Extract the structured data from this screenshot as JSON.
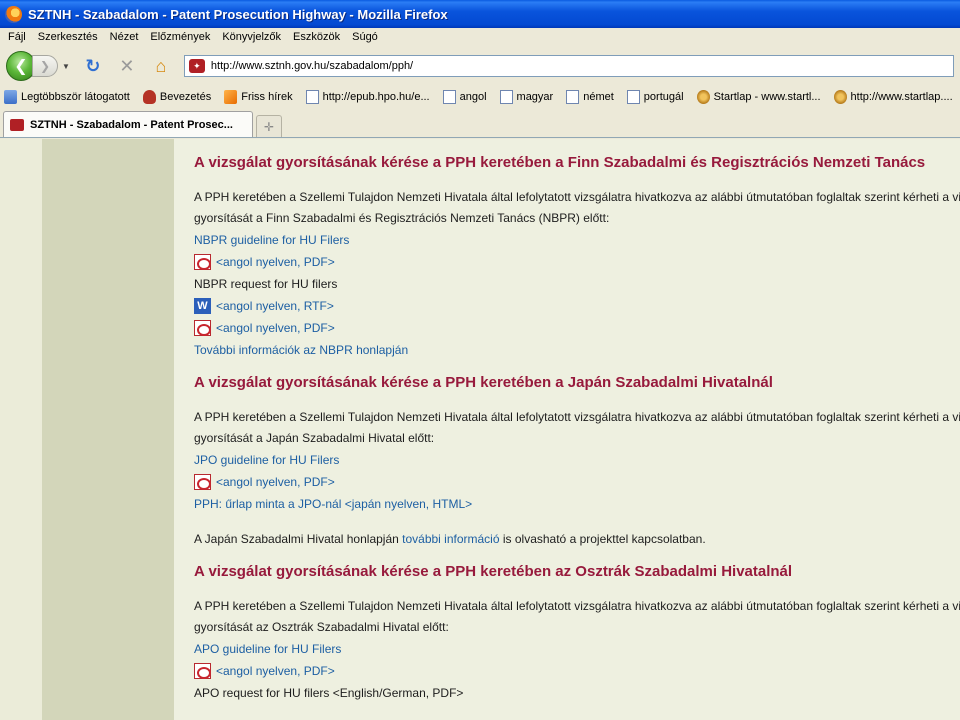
{
  "window": {
    "title": "SZTNH - Szabadalom - Patent Prosecution Highway - Mozilla Firefox"
  },
  "menu": {
    "items": [
      "Fájl",
      "Szerkesztés",
      "Nézet",
      "Előzmények",
      "Könyvjelzők",
      "Eszközök",
      "Súgó"
    ]
  },
  "nav": {
    "url": "http://www.sztnh.gov.hu/szabadalom/pph/"
  },
  "bookmarks": {
    "items": [
      {
        "label": "Legtöbbször látogatott",
        "icon": "folder-icon"
      },
      {
        "label": "Bevezetés",
        "icon": "red-icon"
      },
      {
        "label": "Friss hírek",
        "icon": "rss-icon"
      },
      {
        "label": "http://epub.hpo.hu/e...",
        "icon": "page-icon"
      },
      {
        "label": "angol",
        "icon": "page-icon"
      },
      {
        "label": "magyar",
        "icon": "page-icon"
      },
      {
        "label": "német",
        "icon": "page-icon"
      },
      {
        "label": "portugál",
        "icon": "page-icon"
      },
      {
        "label": "Startlap - www.startl...",
        "icon": "lion-icon"
      },
      {
        "label": "http://www.startlap....",
        "icon": "lion-icon"
      }
    ]
  },
  "tabs": {
    "active_label": "SZTNH - Szabadalom - Patent Prosec..."
  },
  "sections": {
    "finn": {
      "heading": "A vizsgálat gyorsításának kérése a PPH keretében a Finn Szabadalmi és Regisztrációs Nemzeti Tanács",
      "para1": "A PPH keretében a Szellemi Tulajdon Nemzeti Hivatala által lefolytatott vizsgálatra hivatkozva az alábbi útmutatóban foglaltak szerint kérheti a vizsgálat",
      "para2": "gyorsítását a Finn Szabadalmi és Regisztrációs Nemzeti Tanács (NBPR) előtt:",
      "guideline_link": "NBPR guideline for HU Filers",
      "pdf_link": "<angol nyelven, PDF>",
      "request_text": "NBPR request for HU filers",
      "rtf_link": "<angol nyelven, RTF>",
      "pdf_link2": "<angol nyelven, PDF>",
      "more_link": "További információk az NBPR honlapján"
    },
    "japan": {
      "heading": "A vizsgálat gyorsításának kérése a PPH keretében a Japán Szabadalmi Hivatalnál",
      "para1": "A PPH keretében a Szellemi Tulajdon Nemzeti Hivatala által lefolytatott vizsgálatra hivatkozva az alábbi útmutatóban foglaltak szerint kérheti a vizsgálat",
      "para2": "gyorsítását a Japán Szabadalmi Hivatal előtt:",
      "guideline_link": "JPO guideline for HU Filers",
      "pdf_link": "<angol nyelven, PDF>",
      "form_link": "PPH: űrlap minta a JPO-nál <japán nyelven, HTML>",
      "info_before": "A Japán Szabadalmi Hivatal honlapján ",
      "info_link": "további információ",
      "info_after": " is olvasható a projekttel kapcsolatban."
    },
    "austria": {
      "heading": "A vizsgálat gyorsításának kérése a PPH keretében az Osztrák Szabadalmi Hivatalnál",
      "para1": "A PPH keretében a Szellemi Tulajdon Nemzeti Hivatala által lefolytatott vizsgálatra hivatkozva az alábbi útmutatóban foglaltak szerint kérheti a vizsgálat",
      "para2": "gyorsítását az Osztrák Szabadalmi Hivatal előtt:",
      "guideline_link": "APO guideline for HU Filers",
      "pdf_link": "<angol nyelven, PDF>",
      "request_text": "APO request for HU filers <English/German, PDF>"
    }
  }
}
